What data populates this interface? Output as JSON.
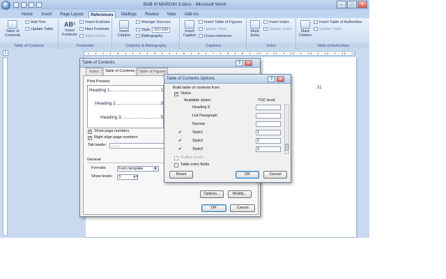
{
  "window": {
    "title": "BAB III MARGIN 3.docx - Microsoft Word",
    "minimize": "–",
    "maximize": "□",
    "close": "✕"
  },
  "tabs": [
    "Home",
    "Insert",
    "Page Layout",
    "References",
    "Mailings",
    "Review",
    "View",
    "Add-Ins"
  ],
  "active_tab": "References",
  "ribbon": {
    "toc": {
      "big_label": "Table of Contents",
      "add_text": "Add Text",
      "update_table": "Update Table",
      "group": "Table of Contents"
    },
    "footnotes": {
      "insert_footnote": "Insert Footnote",
      "insert_endnote": "Insert Endnote",
      "next_footnote": "Next Footnote",
      "show_notes": "Show Notes",
      "glyph": "AB¹",
      "group": "Footnotes"
    },
    "citations": {
      "insert_citation": "Insert Citation",
      "manage_sources": "Manage Sources",
      "style_label": "Style:",
      "style_value": "ISO 690",
      "bibliography": "Bibliography",
      "group": "Citations & Bibliography"
    },
    "captions": {
      "insert_caption": "Insert Caption",
      "insert_tof": "Insert Table of Figures",
      "update_table": "Update Table",
      "cross_reference": "Cross-reference",
      "group": "Captions"
    },
    "index": {
      "mark_entry": "Mark Entry",
      "insert_index": "Insert Index",
      "update_index": "Update Index",
      "group": "Index"
    },
    "toa": {
      "mark_citation": "Mark Citation",
      "insert_toa": "Insert Table of Authorities",
      "update_table": "Update Table",
      "group": "Table of Authorities"
    }
  },
  "ruler": {
    "text": "· 1 · 2 · 1 · 1 · X · 1 · 1 · 2 · 1 · 3 · 1 · 4 · 1 · 5 · 1 · 6 · 1 · 7 · 1 · 8 · 1 · 9 · 1 · 10 · 1 · 11 · 1 · 12 · 1 · 13 · 1 · 14 · 1 · 15 · 16 · 17 ·"
  },
  "document": {
    "page_number": "31"
  },
  "toc_dialog": {
    "title": "Table of Contents",
    "help": "?",
    "close": "✕",
    "tabs": [
      "Index",
      "Table of Contents",
      "Table of Figures"
    ],
    "print_preview_label": "Print Preview",
    "preview_lines": [
      {
        "text": "Heading 1",
        "page": "1"
      },
      {
        "text": "Heading 2",
        "page": "3"
      },
      {
        "text": "Heading 3",
        "page": "5"
      }
    ],
    "show_page_numbers": "Show page numbers",
    "right_align": "Right align page numbers",
    "tab_leader_label": "Tab leader:",
    "tab_leader_value": "........",
    "general_label": "General",
    "formats_label": "Formats:",
    "formats_value": "From template",
    "show_levels_label": "Show levels:",
    "show_levels_value": "3",
    "options_button": "Options...",
    "modify_button": "Modify...",
    "ok": "OK",
    "cancel": "Cancel"
  },
  "options_dialog": {
    "title": "Table of Contents Options",
    "help": "?",
    "close": "✕",
    "build_from": "Build table of contents from:",
    "styles_label": "Styles",
    "available_styles": "Available styles:",
    "toc_level": "TOC level:",
    "styles": [
      {
        "name": "Heading 9",
        "checked": "",
        "level": ""
      },
      {
        "name": "List Paragraph",
        "checked": "",
        "level": ""
      },
      {
        "name": "Normal",
        "checked": "",
        "level": ""
      },
      {
        "name": "Style1",
        "checked": "✔",
        "level": "1"
      },
      {
        "name": "Style2",
        "checked": "✔",
        "level": "2"
      },
      {
        "name": "Style3",
        "checked": "✔",
        "level": "3"
      }
    ],
    "outline_levels": "Outline levels",
    "table_entry_fields": "Table entry fields",
    "reset": "Reset",
    "ok": "OK",
    "cancel": "Cancel"
  }
}
